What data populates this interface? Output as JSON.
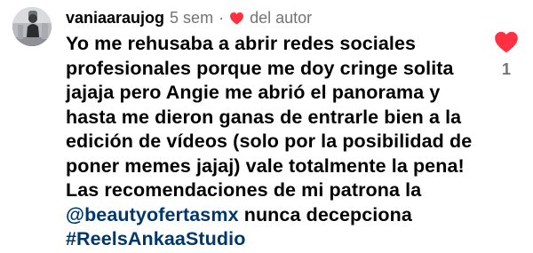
{
  "comment": {
    "username": "vaniaaraujog",
    "time": "5 sem",
    "separator": "·",
    "author_label": "del autor",
    "lines": [
      [
        {
          "text": "Yo me rehusaba a abrir redes sociales"
        }
      ],
      [
        {
          "text": "profesionales porque me doy cringe solita"
        }
      ],
      [
        {
          "text": "jajaja pero Angie me abrió el panorama y"
        }
      ],
      [
        {
          "text": "hasta me dieron ganas de entrarle bien a la"
        }
      ],
      [
        {
          "text": "edición de vídeos (solo por la posibilidad de"
        }
      ],
      [
        {
          "text": "poner memes jajaj) vale totalmente la pena!"
        }
      ],
      [
        {
          "text": "Las recomendaciones de mi patrona la"
        }
      ],
      [
        {
          "text": "@beautyofertasmx",
          "tag": true
        },
        {
          "text": " nunca decepciona"
        }
      ],
      [
        {
          "text": "#ReelsAnkaaStudio",
          "tag": true
        }
      ]
    ],
    "like_count": "1"
  },
  "colors": {
    "heart": "#ff3040",
    "muted": "#737373",
    "link": "#00376b"
  },
  "icons": {
    "like": "heart-filled-icon",
    "author_like": "heart-filled-icon"
  }
}
